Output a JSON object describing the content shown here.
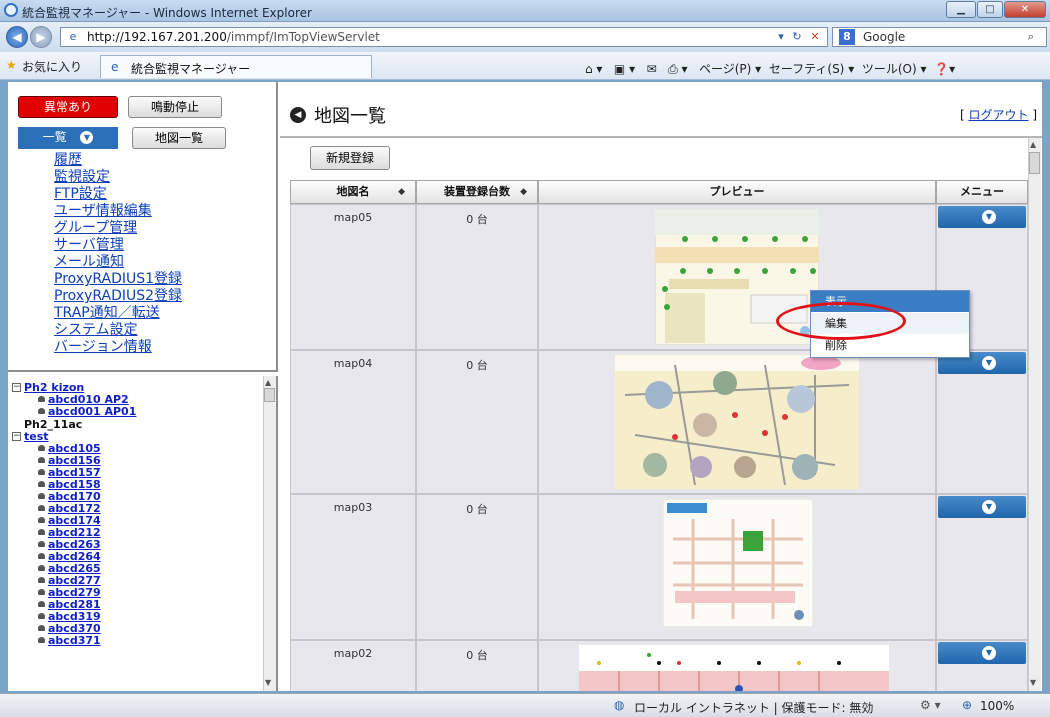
{
  "window": {
    "title": "統合監視マネージャー - Windows Internet Explorer"
  },
  "addressbar": {
    "url_host": "http://192.167.201.200",
    "url_path": "/immpf/ImTopViewServlet",
    "search_engine": "Google"
  },
  "favorites": {
    "label": "お気に入り",
    "tab_title": "統合監視マネージャー",
    "page_menu": "ページ(P)",
    "safety_menu": "セーフティ(S)",
    "tools_menu": "ツール(O)"
  },
  "left_panel": {
    "alarm_button": "異常あり",
    "buzzer_button": "鳴動停止",
    "list_select": "一覧",
    "map_list_button": "地図一覧",
    "menu": [
      "履歴",
      "監視設定",
      "FTP設定",
      "ユーザ情報編集",
      "グループ管理",
      "サーバ管理",
      "メール通知",
      "ProxyRADIUS1登録",
      "ProxyRADIUS2登録",
      "TRAP通知／転送",
      "システム設定",
      "バージョン情報"
    ]
  },
  "tree": {
    "group1": "Ph2 kizon",
    "group1_items": [
      "abcd010 AP2",
      "abcd001 AP01"
    ],
    "standalone": "Ph2_11ac",
    "group2": "test",
    "group2_items": [
      "abcd105",
      "abcd156",
      "abcd157",
      "abcd158",
      "abcd170",
      "abcd172",
      "abcd174",
      "abcd212",
      "abcd263",
      "abcd264",
      "abcd265",
      "abcd277",
      "abcd279",
      "abcd281",
      "abcd319",
      "abcd370",
      "abcd371"
    ]
  },
  "main": {
    "page_title": "地図一覧",
    "logout_open": "[ ",
    "logout_label": "ログアウト",
    "logout_close": " ]",
    "new_button": "新規登録",
    "columns": [
      "地図名",
      "装置登録台数",
      "プレビュー",
      "メニュー"
    ],
    "rows": [
      {
        "name": "map05",
        "count": "0 台"
      },
      {
        "name": "map04",
        "count": "0 台"
      },
      {
        "name": "map03",
        "count": "0 台"
      },
      {
        "name": "map02",
        "count": "0 台"
      }
    ],
    "context_menu": [
      "表示",
      "編集",
      "削除"
    ]
  },
  "statusbar": {
    "zone": "ローカル イントラネット | 保護モード: 無効",
    "zoom": "100%"
  },
  "colors": {
    "accent": "#1f66ac",
    "alarm": "#e00000",
    "highlight_ellipse": "#e0131b"
  }
}
